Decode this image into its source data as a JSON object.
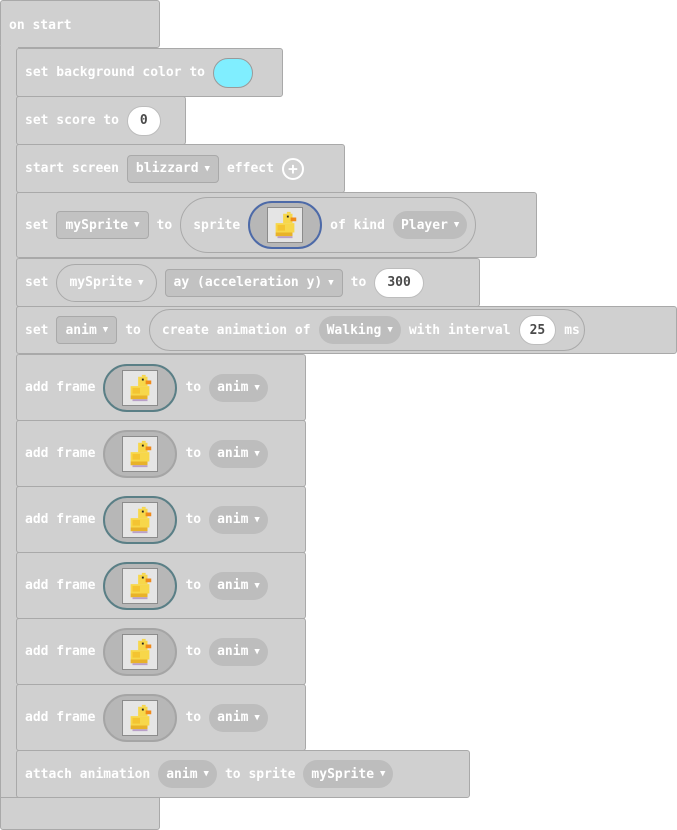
{
  "hat": {
    "label": "on start"
  },
  "bg": {
    "set": "set background color to",
    "color": "#80eeff"
  },
  "score": {
    "set": "set score to",
    "value": "0"
  },
  "effect": {
    "start": "start screen",
    "name": "blizzard",
    "effect": "effect"
  },
  "sprite": {
    "set": "set",
    "var": "mySprite",
    "to": "to",
    "sprite": "sprite",
    "ofkind": "of kind",
    "kind": "Player"
  },
  "accel": {
    "set": "set",
    "var": "mySprite",
    "prop": "ay (acceleration y)",
    "to": "to",
    "value": "300"
  },
  "anim": {
    "set": "set",
    "var": "anim",
    "to": "to",
    "create": "create animation of",
    "name": "Walking",
    "with": "with interval",
    "interval": "25",
    "ms": "ms"
  },
  "frames": [
    {
      "add": "add frame",
      "to": "to",
      "var": "anim"
    },
    {
      "add": "add frame",
      "to": "to",
      "var": "anim"
    },
    {
      "add": "add frame",
      "to": "to",
      "var": "anim"
    },
    {
      "add": "add frame",
      "to": "to",
      "var": "anim"
    },
    {
      "add": "add frame",
      "to": "to",
      "var": "anim"
    },
    {
      "add": "add frame",
      "to": "to",
      "var": "anim"
    }
  ],
  "attach": {
    "label": "attach animation",
    "var": "anim",
    "tosprite": "to sprite",
    "sprite": "mySprite"
  },
  "icons": {
    "dropdown": "caret-down-icon",
    "plus": "plus-circle-icon",
    "duck": "duck-sprite-icon"
  }
}
